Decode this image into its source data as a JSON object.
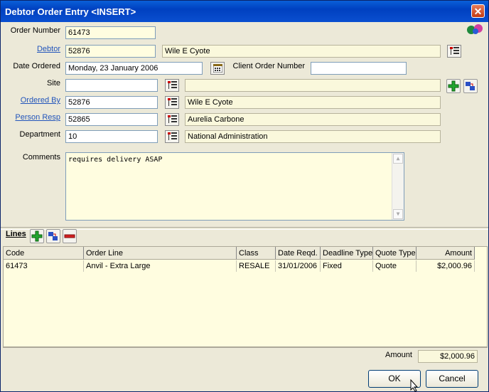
{
  "window": {
    "title": "Debtor Order Entry <INSERT>",
    "close_glyph": "✕"
  },
  "form": {
    "order_number": {
      "label": "Order Number",
      "value": "61473"
    },
    "debtor": {
      "label": "Debtor",
      "code": "52876",
      "name": "Wile E Cyote"
    },
    "date_ordered": {
      "label": "Date Ordered",
      "value": "Monday, 23 January 2006"
    },
    "client_order_number": {
      "label": "Client Order Number",
      "value": ""
    },
    "site": {
      "label": "Site",
      "code": "",
      "name": ""
    },
    "ordered_by": {
      "label": "Ordered By",
      "code": "52876",
      "name": "Wile E Cyote"
    },
    "person_resp": {
      "label": "Person Resp",
      "code": "52865",
      "name": "Aurelia Carbone"
    },
    "department": {
      "label": "Department",
      "code": "10",
      "name": "National Administration"
    },
    "comments": {
      "label": "Comments",
      "value": "requires delivery ASAP"
    }
  },
  "lines": {
    "label": "Lines",
    "columns": [
      "Code",
      "Order Line",
      "Class",
      "Date Reqd.",
      "Deadline Type",
      "Quote Type",
      "Amount"
    ],
    "rows": [
      {
        "code": "61473",
        "order_line": "Anvil - Extra Large",
        "class": "RESALE",
        "date_reqd": "31/01/2006",
        "deadline_type": "Fixed",
        "quote_type": "Quote",
        "amount": "$2,000.96"
      }
    ]
  },
  "summary": {
    "amount_label": "Amount",
    "amount_value": "$2,000.96"
  },
  "buttons": {
    "ok": "OK",
    "cancel": "Cancel"
  },
  "colors": {
    "title_bar": "#0a4fd0",
    "field_bg": "#fffde0",
    "window_bg": "#ece9d8",
    "link": "#2255bb"
  }
}
